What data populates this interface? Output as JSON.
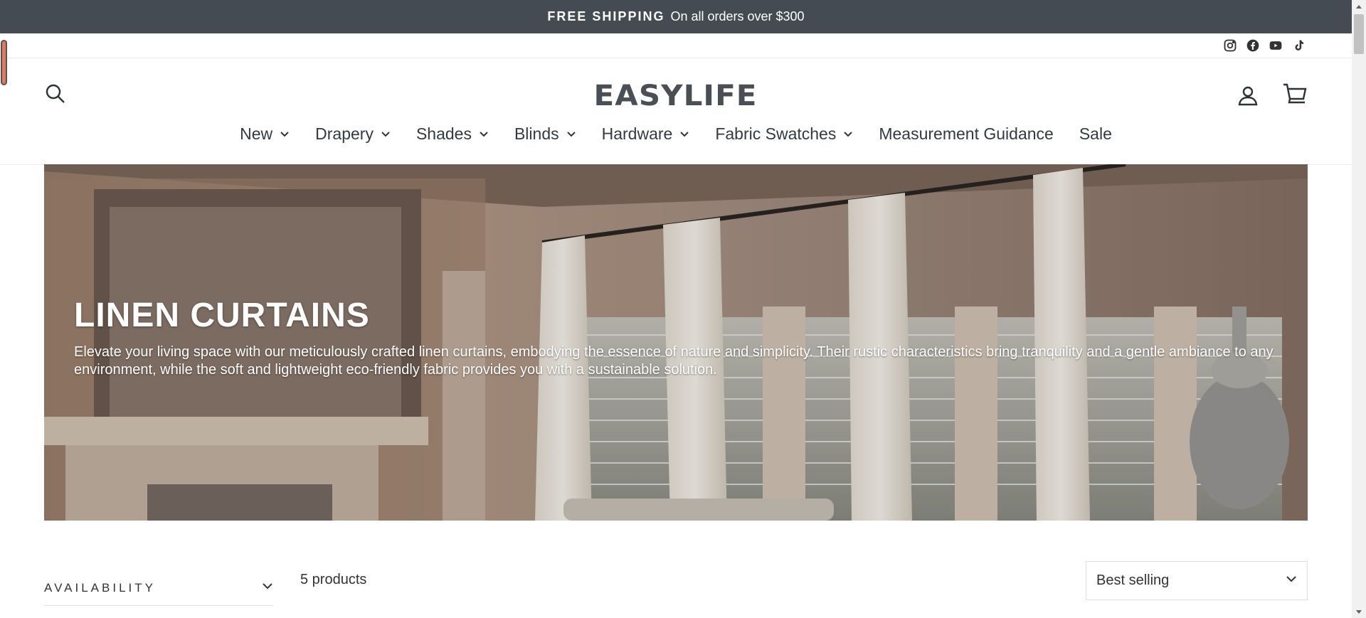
{
  "announcement": {
    "strong": "FREE SHIPPING",
    "text": "On all orders over $300"
  },
  "social": [
    "instagram-icon",
    "facebook-icon",
    "youtube-icon",
    "tiktok-icon"
  ],
  "header": {
    "logo": "EASYLIFE",
    "icons": {
      "search": "search-icon",
      "account": "account-icon",
      "cart": "cart-icon"
    }
  },
  "nav": {
    "items": [
      {
        "label": "New",
        "dropdown": true
      },
      {
        "label": "Drapery",
        "dropdown": true
      },
      {
        "label": "Shades",
        "dropdown": true
      },
      {
        "label": "Blinds",
        "dropdown": true
      },
      {
        "label": "Hardware",
        "dropdown": true
      },
      {
        "label": "Fabric Swatches",
        "dropdown": true
      },
      {
        "label": "Measurement Guidance",
        "dropdown": false
      },
      {
        "label": "Sale",
        "dropdown": false
      }
    ]
  },
  "hero": {
    "title": "LINEN CURTAINS",
    "description": "Elevate your living space with our meticulously crafted linen curtains, embodying the essence of nature and simplicity. Their rustic characteristics bring tranquility and a gentle ambiance to any environment, while the soft and lightweight eco-friendly fabric provides you with a sustainable solution."
  },
  "collection": {
    "filter_label": "AVAILABILITY",
    "count_text": "5 products",
    "sort_value": "Best selling"
  },
  "colors": {
    "announcement_bg": "#454b52",
    "text": "#333a40",
    "logo": "#4a4f56"
  }
}
